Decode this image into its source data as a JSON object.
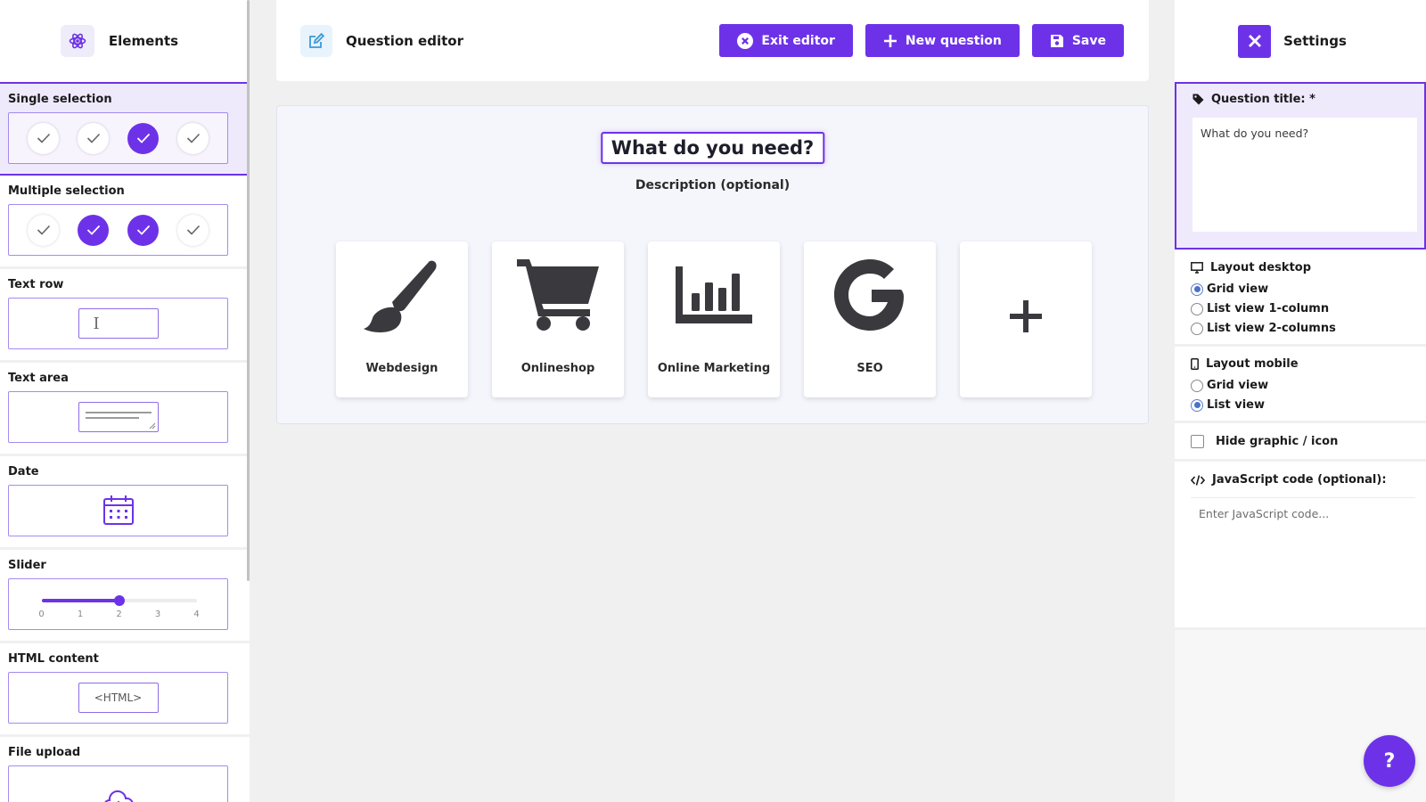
{
  "elements_panel": {
    "title": "Elements",
    "single_selection": "Single selection",
    "multiple_selection": "Multiple selection",
    "text_row": "Text row",
    "text_area": "Text area",
    "date": "Date",
    "slider": "Slider",
    "slider_ticks": [
      "0",
      "1",
      "2",
      "3",
      "4"
    ],
    "slider_value": 2,
    "html_content": "HTML content",
    "html_placeholder": "<HTML>",
    "file_upload": "File upload"
  },
  "editor": {
    "title": "Question editor",
    "exit_label": "Exit editor",
    "new_question_label": "New question",
    "save_label": "Save"
  },
  "question": {
    "title": "What do you need?",
    "description": "Description (optional)",
    "options": [
      {
        "label": "Webdesign",
        "icon": "paintbrush-icon"
      },
      {
        "label": "Onlineshop",
        "icon": "shopping-cart-icon"
      },
      {
        "label": "Online Marketing",
        "icon": "bar-chart-icon"
      },
      {
        "label": "SEO",
        "icon": "google-icon"
      }
    ]
  },
  "settings": {
    "title": "Settings",
    "question_title_label": "Question title: *",
    "question_title_value": "What do you need?",
    "layout_desktop_label": "Layout desktop",
    "desktop_options": [
      "Grid view",
      "List view 1-column",
      "List view 2-columns"
    ],
    "desktop_selected": "Grid view",
    "layout_mobile_label": "Layout mobile",
    "mobile_options": [
      "Grid view",
      "List view"
    ],
    "mobile_selected": "List view",
    "hide_graphic_label": "Hide graphic / icon",
    "hide_graphic_checked": false,
    "js_label": "JavaScript code (optional):",
    "js_placeholder": "Enter JavaScript code..."
  },
  "help_label": "?",
  "colors": {
    "accent": "#6d32e8",
    "accent_light": "#efe9fc",
    "icon_dark": "#3a3a3e"
  }
}
